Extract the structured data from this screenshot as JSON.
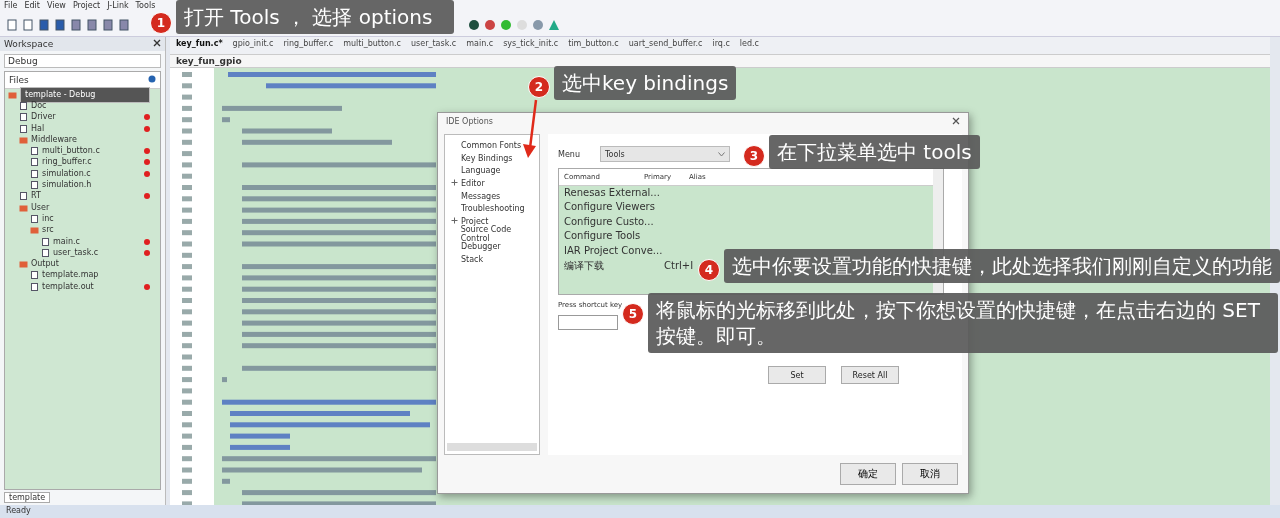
{
  "menu_bar": [
    "File",
    "Edit",
    "View",
    "Project",
    "J-Link",
    "Tools"
  ],
  "workspace": {
    "title": "Workspace",
    "configuration": "Debug",
    "column": "Files",
    "tree": [
      {
        "label": "template - Debug",
        "marked": false,
        "selected": true,
        "children": [
          {
            "label": "Doc",
            "marked": false,
            "selected": false
          },
          {
            "label": "Driver",
            "marked": true,
            "selected": false
          },
          {
            "label": "Hal",
            "marked": true,
            "selected": false
          },
          {
            "label": "Middleware",
            "marked": false,
            "selected": false,
            "children": [
              {
                "label": "multi_button.c",
                "marked": true,
                "selected": false
              },
              {
                "label": "ring_buffer.c",
                "marked": true,
                "selected": false
              },
              {
                "label": "simulation.c",
                "marked": true,
                "selected": false
              },
              {
                "label": "simulation.h",
                "marked": false,
                "selected": false
              }
            ]
          },
          {
            "label": "RT",
            "marked": true,
            "selected": false
          },
          {
            "label": "User",
            "marked": false,
            "selected": false,
            "children": [
              {
                "label": "inc",
                "marked": false,
                "selected": false
              },
              {
                "label": "src",
                "marked": false,
                "selected": false,
                "children": [
                  {
                    "label": "main.c",
                    "marked": true,
                    "selected": false
                  },
                  {
                    "label": "user_task.c",
                    "marked": true,
                    "selected": false
                  }
                ]
              }
            ]
          },
          {
            "label": "Output",
            "marked": false,
            "selected": false,
            "children": [
              {
                "label": "template.map",
                "marked": false,
                "selected": false
              },
              {
                "label": "template.out",
                "marked": true,
                "selected": false
              }
            ]
          }
        ]
      }
    ],
    "bottom_tab": "template"
  },
  "editor": {
    "tabs": [
      {
        "label": "key_fun.c*",
        "selected": true
      },
      {
        "label": "gpio_init.c",
        "selected": false
      },
      {
        "label": "ring_buffer.c",
        "selected": false
      },
      {
        "label": "multi_button.c",
        "selected": false
      },
      {
        "label": "user_task.c",
        "selected": false
      },
      {
        "label": "main.c",
        "selected": false
      },
      {
        "label": "sys_tick_init.c",
        "selected": false
      },
      {
        "label": "tim_button.c",
        "selected": false
      },
      {
        "label": "uart_send_buffer.c",
        "selected": false
      },
      {
        "label": "irq.c",
        "selected": false
      },
      {
        "label": "led.c",
        "selected": false
      }
    ],
    "function": "key_fun_gpio"
  },
  "dialog": {
    "title": "IDE Options",
    "categories": [
      {
        "label": "Common Fonts",
        "expandable": false
      },
      {
        "label": "Key Bindings",
        "expandable": false
      },
      {
        "label": "Language",
        "expandable": false
      },
      {
        "label": "Editor",
        "expandable": true
      },
      {
        "label": "Messages",
        "expandable": false
      },
      {
        "label": "Troubleshooting",
        "expandable": false
      },
      {
        "label": "Project",
        "expandable": true
      },
      {
        "label": "Source Code Control",
        "expandable": false
      },
      {
        "label": "Debugger",
        "expandable": false
      },
      {
        "label": "Stack",
        "expandable": false
      }
    ],
    "menu_label": "Menu",
    "menu_value": "Tools",
    "columns": [
      "Command",
      "Primary",
      "Alias"
    ],
    "rows": [
      [
        "Renesas External...",
        "",
        ""
      ],
      [
        "Configure Viewers",
        "",
        ""
      ],
      [
        "Configure Custo...",
        "",
        ""
      ],
      [
        "Configure Tools",
        "",
        ""
      ],
      [
        "IAR Project Conve...",
        "",
        ""
      ],
      [
        "编译下载",
        "Ctrl+I",
        ""
      ]
    ],
    "shortcut_label": "Press shortcut key",
    "buttons": [
      "Set",
      "Reset All"
    ],
    "footer_buttons": [
      "确定",
      "取消"
    ]
  },
  "callouts": [
    {
      "number": "1",
      "text": "打开 Tools ， 选择 options"
    },
    {
      "number": "2",
      "text": "选中key bindings"
    },
    {
      "number": "3",
      "text": "在下拉菜单选中 tools"
    },
    {
      "number": "4",
      "text": "选中你要设置功能的快捷键，此处选择我们刚刚自定义的功能"
    },
    {
      "number": "5",
      "text": "将鼠标的光标移到此处，按下你想设置的快捷键，在点击右边的 SET 按键。即可。"
    }
  ],
  "status_bar": "Ready"
}
